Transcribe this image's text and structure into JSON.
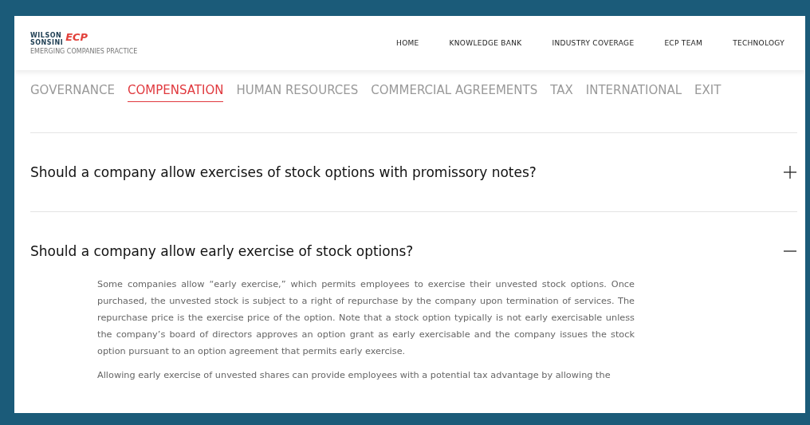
{
  "logo": {
    "line_1": "WILSON",
    "line_2": "SONSINI",
    "mark": "ECP",
    "tagline": "EMERGING COMPANIES PRACTICE"
  },
  "nav": [
    {
      "label": "HOME"
    },
    {
      "label": "KNOWLEDGE BANK"
    },
    {
      "label": "INDUSTRY COVERAGE"
    },
    {
      "label": "ECP TEAM"
    },
    {
      "label": "TECHNOLOGY"
    }
  ],
  "tabs": [
    {
      "label": "GOVERNANCE",
      "selected": false
    },
    {
      "label": "COMPENSATION",
      "selected": true
    },
    {
      "label": "HUMAN RESOURCES",
      "selected": false
    },
    {
      "label": "COMMERCIAL AGREEMENTS",
      "selected": false
    },
    {
      "label": "TAX",
      "selected": false
    },
    {
      "label": "INTERNATIONAL",
      "selected": false
    },
    {
      "label": "EXIT",
      "selected": false
    }
  ],
  "faq": [
    {
      "question": "Should a company allow exercises of stock options with promissory notes?",
      "expanded": false
    },
    {
      "question": "Should a company allow early exercise of stock options?",
      "expanded": true,
      "answer": [
        "Some companies allow “early exercise,” which permits employees to exercise their unvested stock options. Once purchased, the unvested stock is subject to a right of repurchase by the company upon termination of services. The repurchase price is the exercise price of the option. Note that a stock option typically is not early exercisable unless the company’s board of directors approves an option grant as early exercisable and the company issues the stock option pursuant to an option agreement that permits early exercise.",
        "Allowing early exercise of unvested shares can provide employees with a potential tax advantage by allowing the"
      ]
    }
  ]
}
